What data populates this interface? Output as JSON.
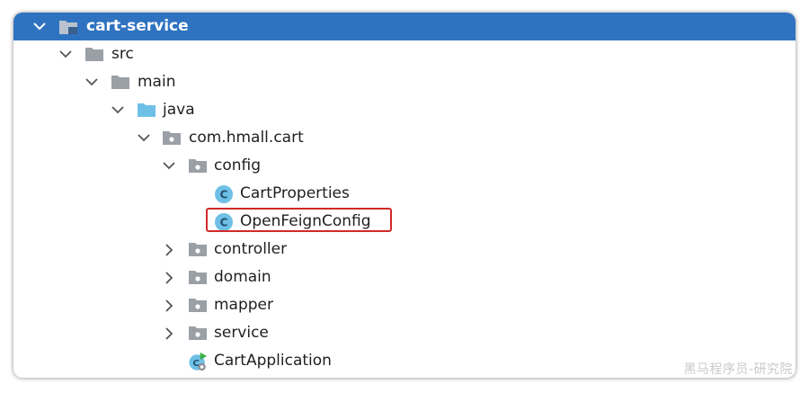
{
  "tree": {
    "root": {
      "label": "cart-service",
      "icon": "module-folder-icon",
      "expanded": true
    },
    "src": {
      "label": "src",
      "icon": "folder-icon",
      "expanded": true
    },
    "main": {
      "label": "main",
      "icon": "folder-icon",
      "expanded": true
    },
    "java": {
      "label": "java",
      "icon": "source-root-folder-icon",
      "expanded": true
    },
    "package": {
      "label": "com.hmall.cart",
      "icon": "package-icon",
      "expanded": true
    },
    "config": {
      "label": "config",
      "icon": "package-icon",
      "expanded": true
    },
    "cart_properties": {
      "label": "CartProperties",
      "icon": "class-icon"
    },
    "open_feign_config": {
      "label": "OpenFeignConfig",
      "icon": "class-icon",
      "highlighted": true
    },
    "controller": {
      "label": "controller",
      "icon": "package-icon",
      "expanded": false
    },
    "domain": {
      "label": "domain",
      "icon": "package-icon",
      "expanded": false
    },
    "mapper": {
      "label": "mapper",
      "icon": "package-icon",
      "expanded": false
    },
    "service": {
      "label": "service",
      "icon": "package-icon",
      "expanded": false
    },
    "cart_application": {
      "label": "CartApplication",
      "icon": "spring-boot-application-class-icon"
    }
  },
  "watermark": "黑马程序员-研究院",
  "colors": {
    "selection": "#2f73c0",
    "folder": "#9aa0a6",
    "source_folder": "#6fc0e6",
    "class_circle": "#6fc0e6",
    "highlight_border": "#d12a2a"
  }
}
